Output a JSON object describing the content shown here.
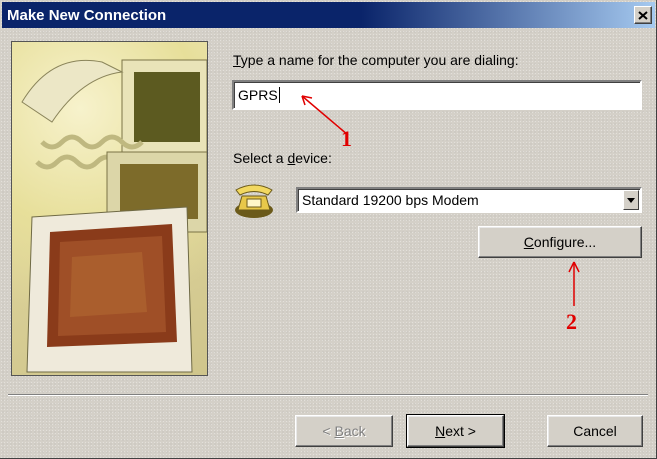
{
  "window": {
    "title": "Make New Connection"
  },
  "name_field": {
    "label_prefix": "",
    "label_accel": "T",
    "label_rest": "ype a name for the computer you are dialing:",
    "value": "GPRS"
  },
  "device": {
    "label_prefix": "Select a ",
    "label_accel": "d",
    "label_rest": "evice:",
    "selected": "Standard 19200 bps Modem"
  },
  "buttons": {
    "configure_accel": "C",
    "configure_rest": "onfigure...",
    "back_prefix": "< ",
    "back_accel": "B",
    "back_rest": "ack",
    "next_accel": "N",
    "next_rest": "ext >",
    "cancel": "Cancel"
  },
  "annotations": {
    "marker_1": "1",
    "marker_2": "2",
    "color": "#e00000"
  },
  "icons": [
    "close-icon",
    "computer-illustration",
    "telephone-icon",
    "dropdown-arrow-icon"
  ]
}
